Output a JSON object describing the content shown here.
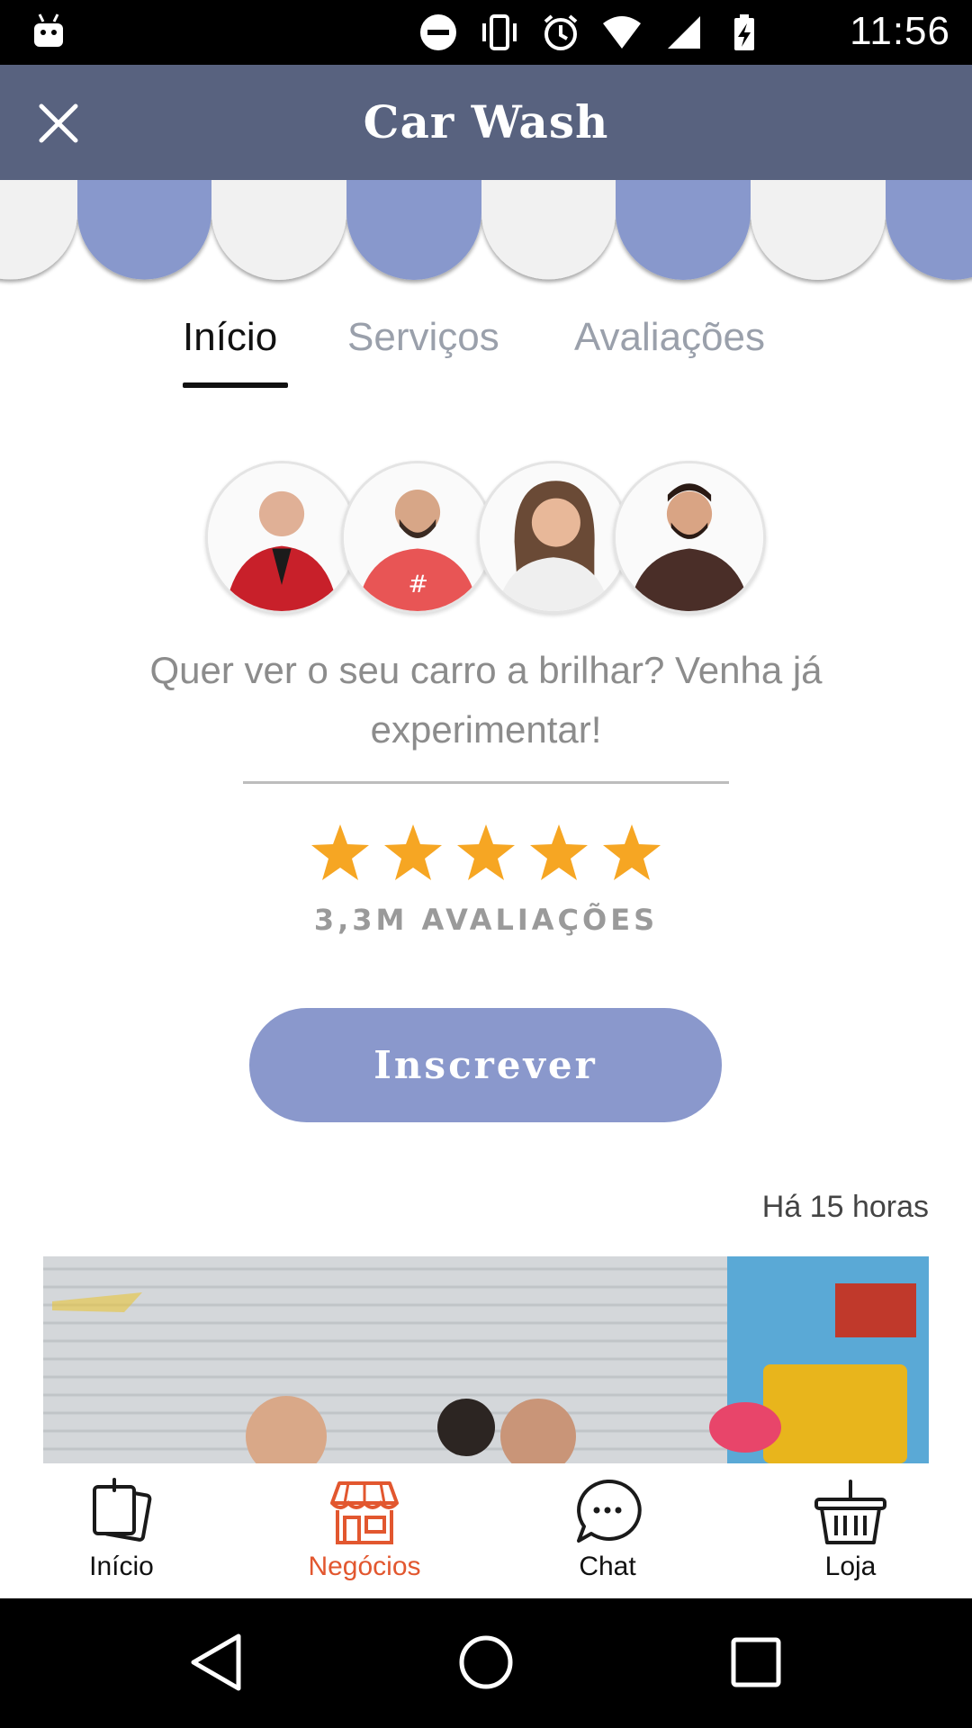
{
  "status_bar": {
    "time": "11:56",
    "icons": [
      "android-debug-icon",
      "do-not-disturb-icon",
      "vibrate-icon",
      "alarm-icon",
      "wifi-icon",
      "signal-icon",
      "battery-charging-icon"
    ]
  },
  "app_bar": {
    "title": "Car Wash",
    "close_icon": "close-icon",
    "color": "#58627f"
  },
  "awning": {
    "colors": [
      "#f1f1f1",
      "#8898cc"
    ]
  },
  "tabs": [
    {
      "label": "Início",
      "active": true
    },
    {
      "label": "Serviços",
      "active": false
    },
    {
      "label": "Avaliações",
      "active": false
    }
  ],
  "business": {
    "description": "Quer ver o seu carro a brilhar? Venha já experimentar!",
    "rating_stars": 5,
    "rating_max": 5,
    "reviews_text": "3,3M AVALIAÇÕES",
    "star_color": "#f6a623",
    "subscribe_label": "Inscrever",
    "subscribe_color": "#8a98cc"
  },
  "post": {
    "timestamp": "Há 15 horas"
  },
  "bottom_nav": [
    {
      "label": "Início",
      "icon": "notes-icon",
      "active": false
    },
    {
      "label": "Negócios",
      "icon": "store-icon",
      "active": true
    },
    {
      "label": "Chat",
      "icon": "chat-bubble-icon",
      "active": false
    },
    {
      "label": "Loja",
      "icon": "basket-icon",
      "active": false
    }
  ],
  "accent_color": "#e2572f",
  "system_nav": [
    "back-icon",
    "home-icon",
    "recents-icon"
  ]
}
